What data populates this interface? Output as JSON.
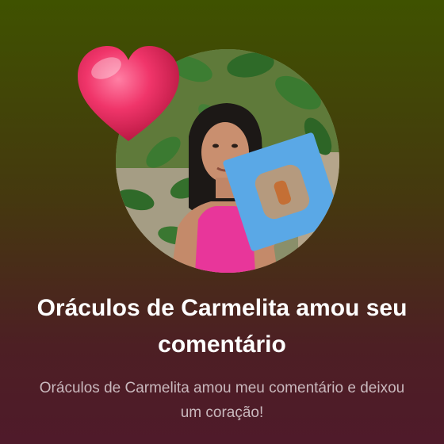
{
  "notification": {
    "title": "Oráculos de Carmelita amou seu comentário",
    "message": "Oráculos de Carmelita amou meu comentário e deixou um coração!"
  },
  "avatar": {
    "icon": "user-photo"
  },
  "badge": {
    "icon": "heart-icon",
    "color": "#f0356a"
  },
  "colors": {
    "background_top": "#3f5200",
    "background_bottom": "#4f1a2a",
    "title_text": "#ffffff",
    "message_text": "#c9b8bd"
  }
}
